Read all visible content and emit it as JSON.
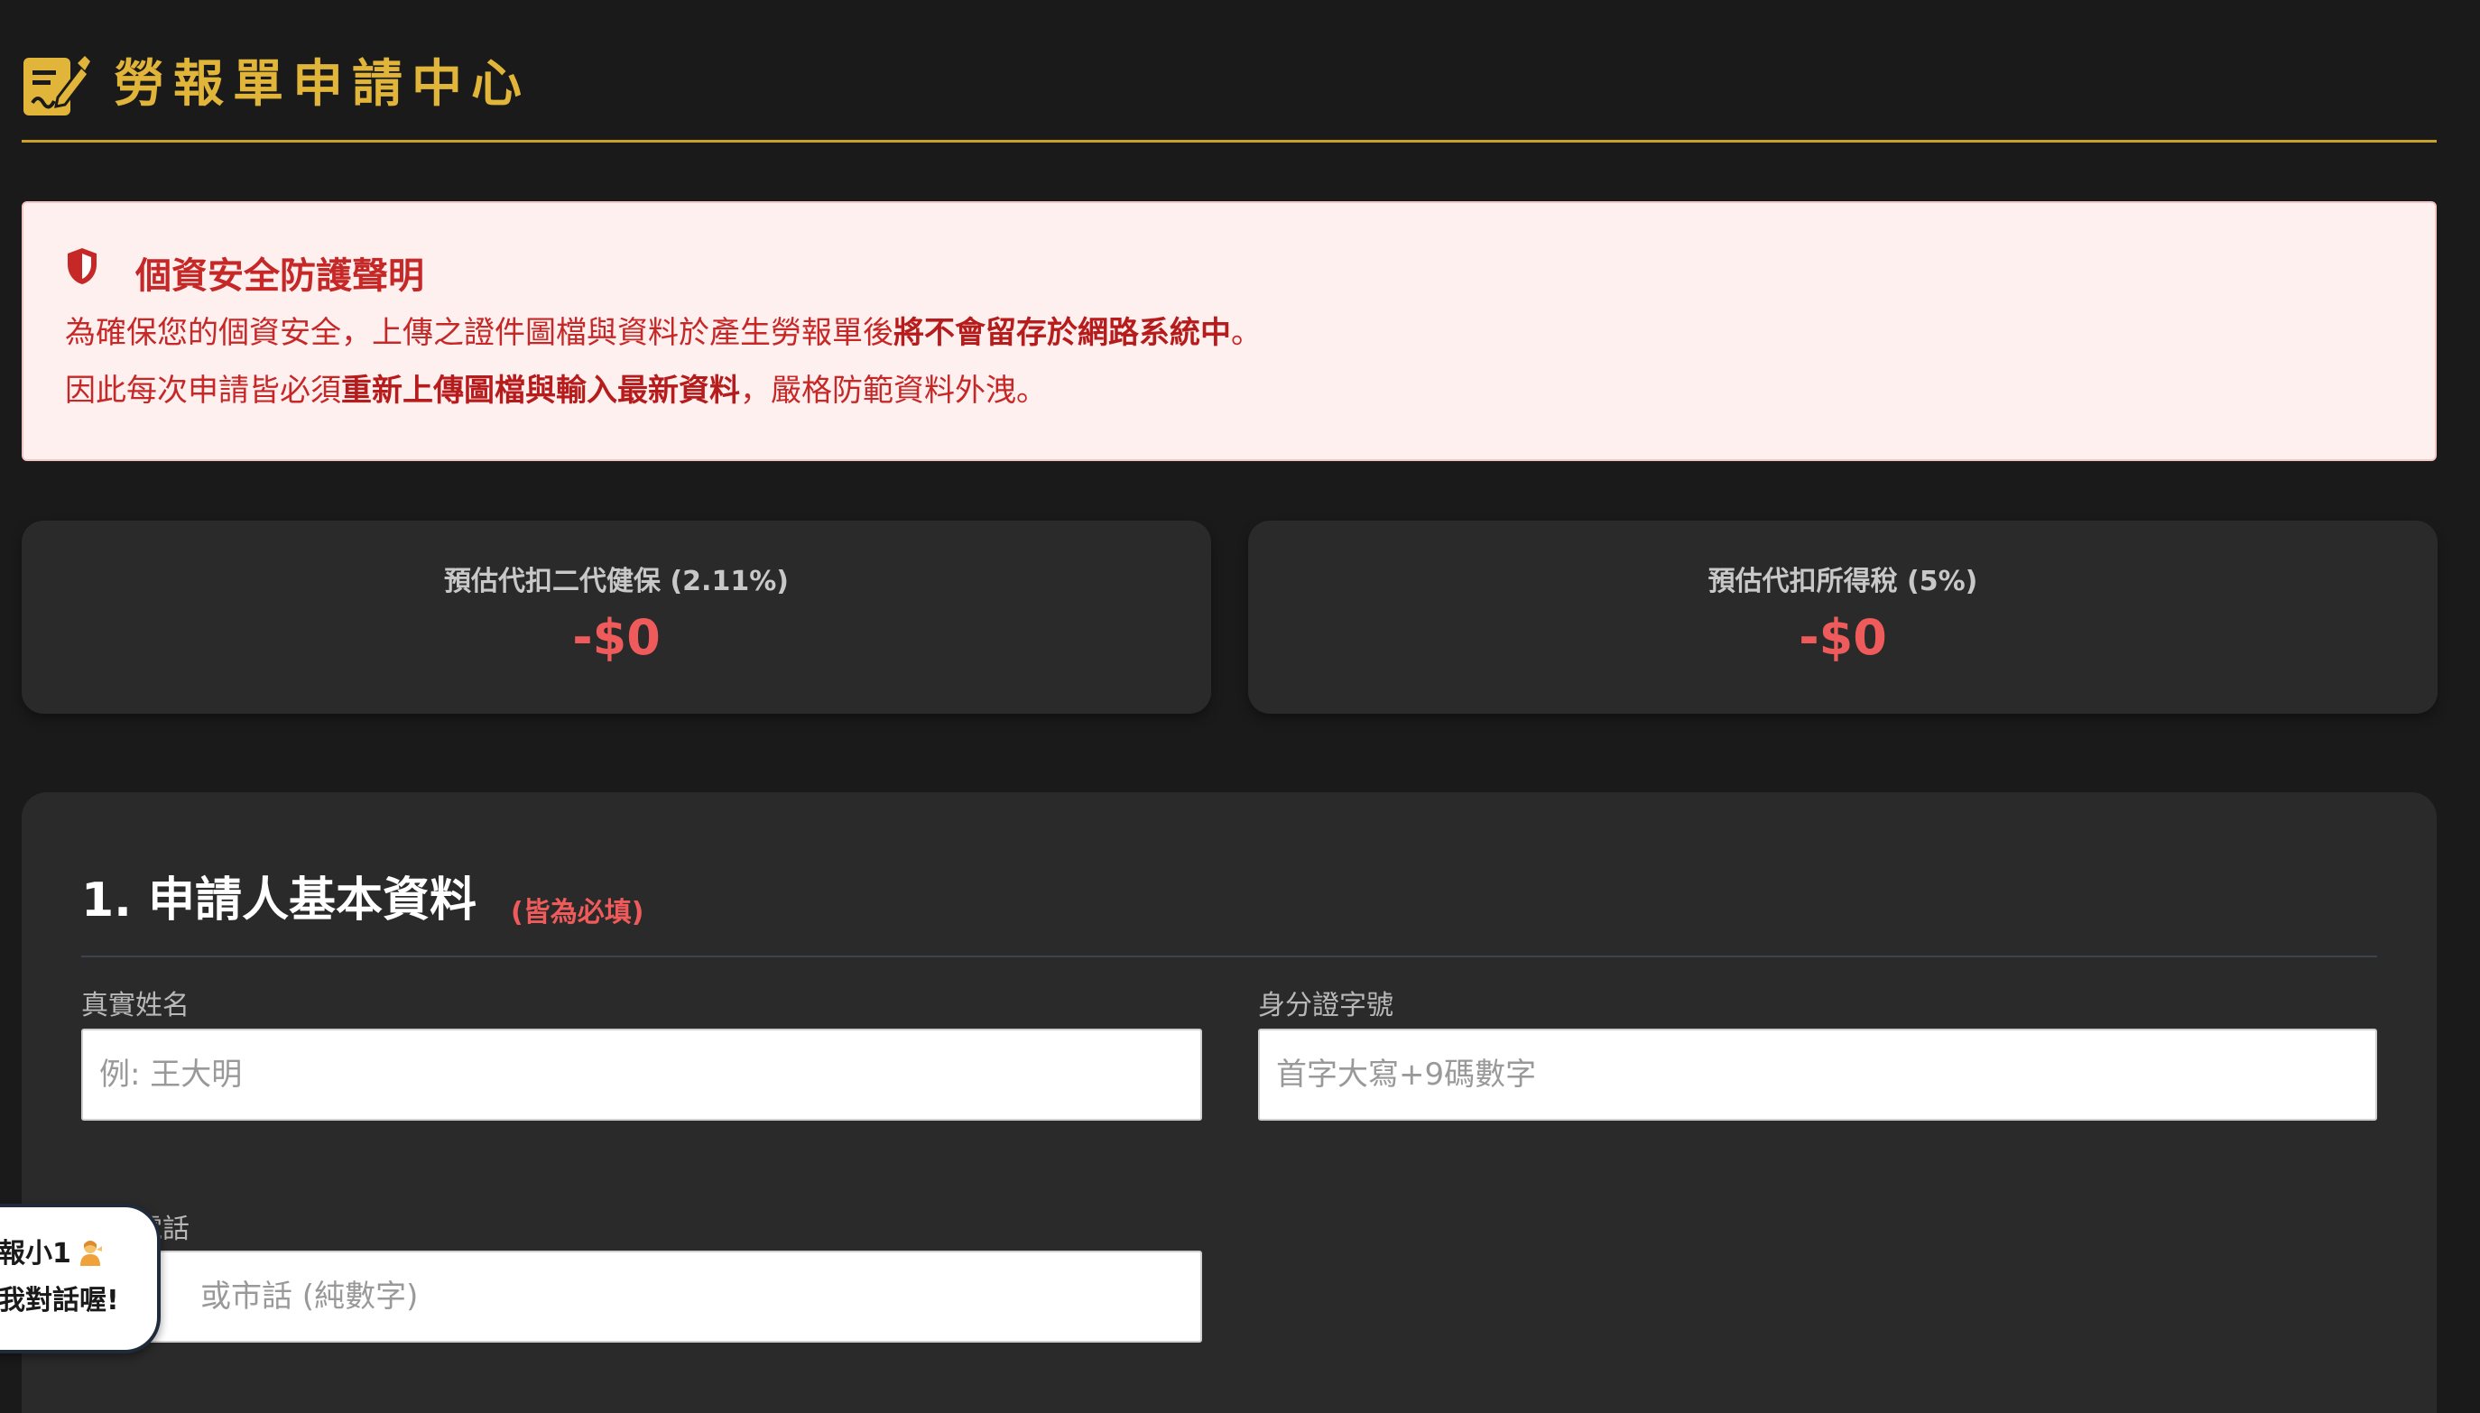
{
  "header": {
    "title": "勞報單申請中心",
    "icon": "edit-document-icon",
    "accent_color": "#e1b53a"
  },
  "notice": {
    "icon": "shield-icon",
    "title": "個資安全防護聲明",
    "line1_pre": "為確保您的個資安全，上傳之證件圖檔與資料於產生勞報單後",
    "line1_bold": "將不會留存於網路系統中",
    "line1_post": "。",
    "line2_pre": "因此每次申請皆必須",
    "line2_bold": "重新上傳圖檔與輸入最新資料",
    "line2_post": "，嚴格防範資料外洩。",
    "text_color": "#c62828",
    "background_color": "#fff0f0"
  },
  "stats": [
    {
      "label": "預估代扣二代健保 (2.11%)",
      "value": "-$0"
    },
    {
      "label": "預估代扣所得稅 (5%)",
      "value": "-$0"
    }
  ],
  "form": {
    "section_title": "1. 申請人基本資料",
    "section_required": "(皆為必填)",
    "fields": {
      "name": {
        "label": "真實姓名",
        "placeholder": "例: 王大明"
      },
      "id_number": {
        "label": "身分證字號",
        "placeholder": "首字大寫+9碼數字"
      },
      "phone": {
        "label": "電話",
        "placeholder": "或市話 (純數字)"
      }
    }
  },
  "chat": {
    "line1": "報小1",
    "line2": "我對話喔!",
    "icon": "person-emoji-icon"
  }
}
